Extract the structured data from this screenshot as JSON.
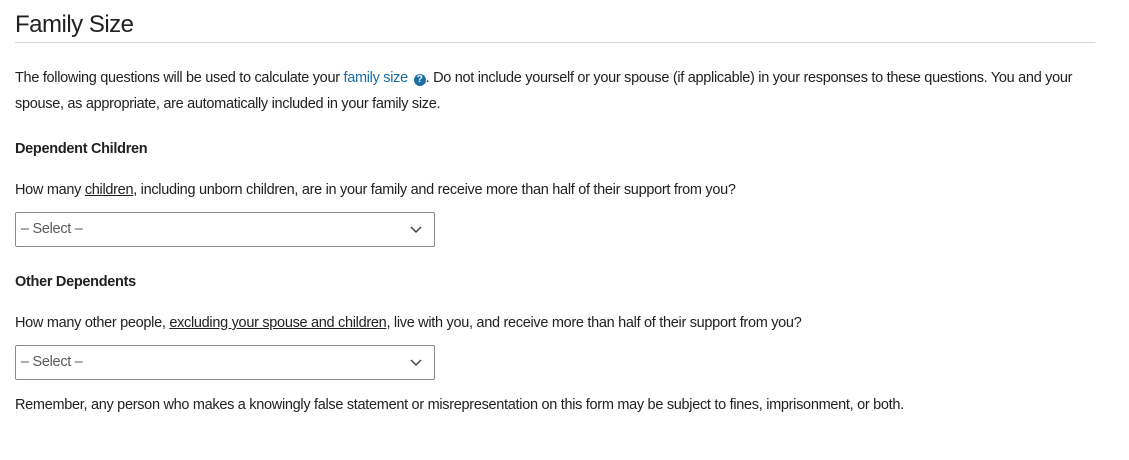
{
  "section": {
    "title": "Family Size"
  },
  "intro": {
    "before_link": "The following questions will be used to calculate your ",
    "link_text": "family size",
    "help_icon": "question-circle-icon",
    "after_link": ". Do not include yourself or your spouse (if applicable) in your responses to these questions. You and your spouse, as appropriate, are automatically included in your family size."
  },
  "dependent_children": {
    "heading": "Dependent Children",
    "question_before": "How many ",
    "question_term": "children",
    "question_after": ", including unborn children, are in your family and receive more than half of their support from you?",
    "select_value": "– Select –"
  },
  "other_dependents": {
    "heading": "Other Dependents",
    "question_before": "How many other people, ",
    "question_term": "excluding your spouse and children",
    "question_after": ", live with you, and receive more than half of their support from you?",
    "select_value": "– Select –"
  },
  "footer": {
    "note": "Remember, any person who makes a knowingly false statement or misrepresentation on this form may be subject to fines, imprisonment, or both."
  },
  "colors": {
    "link": "#1a6fa0",
    "text": "#212121",
    "rule": "#d6d6d6",
    "select_border": "#8a8a8a"
  }
}
